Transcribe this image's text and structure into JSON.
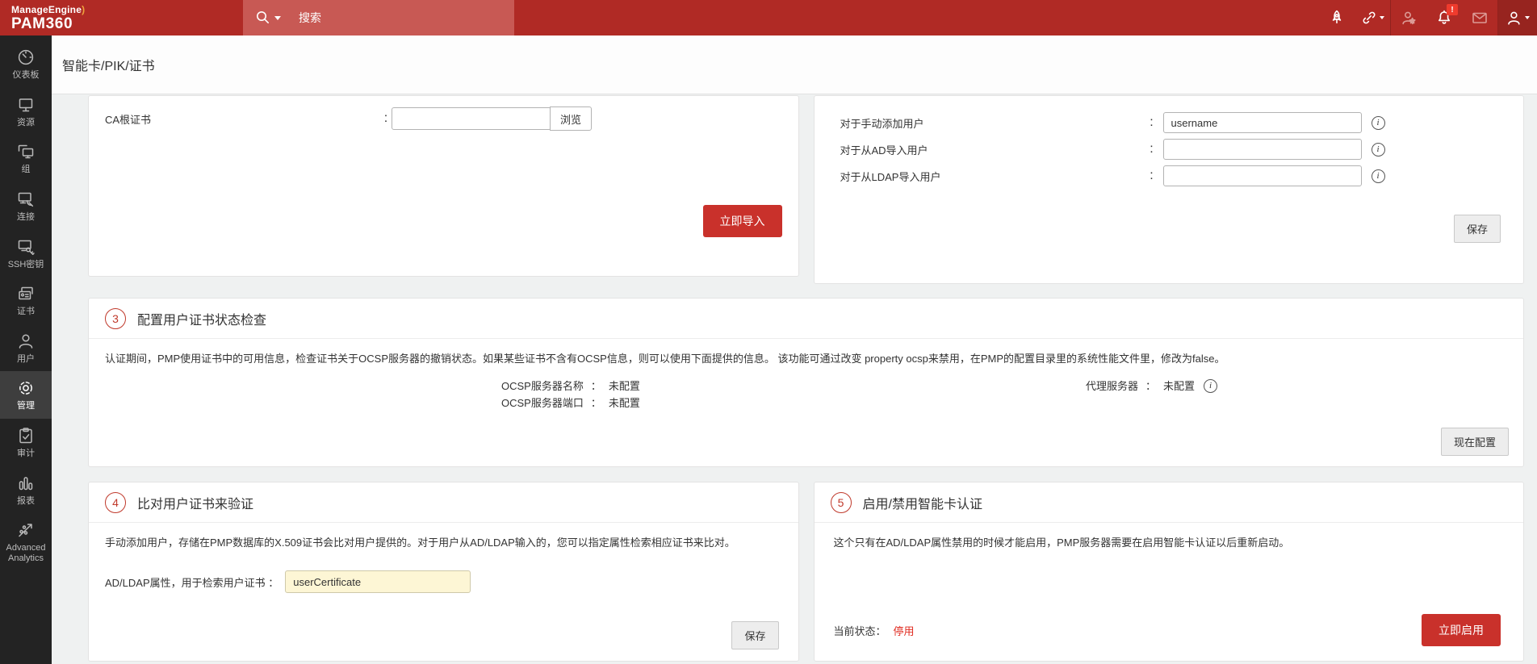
{
  "header": {
    "logo_line1": "ManageEngine",
    "logo_swoosh": ")",
    "logo_line2": "PAM360",
    "search_placeholder": "搜索",
    "icons": [
      "search-icon",
      "rocket-icon",
      "link-icon",
      "user-star-icon",
      "notification-bell-icon",
      "mail-icon",
      "account-icon"
    ],
    "bell_badge": "!"
  },
  "sidebar": {
    "items": [
      {
        "label": "仪表板",
        "icon": "dashboard-gauge-icon",
        "active": false
      },
      {
        "label": "资源",
        "icon": "resources-monitor-icon",
        "active": false
      },
      {
        "label": "组",
        "icon": "groups-monitors-icon",
        "active": false
      },
      {
        "label": "连接",
        "icon": "connections-monitor-dish-icon",
        "active": false
      },
      {
        "label": "SSH密钥",
        "icon": "ssh-keys-monitor-key-icon",
        "active": false
      },
      {
        "label": "证书",
        "icon": "certificates-idcard-icon",
        "active": false
      },
      {
        "label": "用户",
        "icon": "users-person-icon",
        "active": false
      },
      {
        "label": "管理",
        "icon": "admin-gear-icon",
        "active": true
      },
      {
        "label": "审计",
        "icon": "audit-clipboard-icon",
        "active": false
      },
      {
        "label": "报表",
        "icon": "reports-barchart-icon",
        "active": false
      },
      {
        "label": "Advanced Analytics",
        "icon": "advanced-analytics-scatter-icon",
        "active": false
      }
    ]
  },
  "page": {
    "title": "智能卡/PIK/证书"
  },
  "shared": {
    "colon_half": ":",
    "colon_full": "："
  },
  "panels": {
    "import_ca": {
      "label": "CA根证书",
      "browse_label": "浏览",
      "import_button": "立即导入"
    },
    "user_mapping": {
      "rows": [
        {
          "label": "对于手动添加用户",
          "value": "username"
        },
        {
          "label": "对于从AD导入用户",
          "value": ""
        },
        {
          "label": "对于从LDAP导入用户",
          "value": ""
        }
      ],
      "save_label": "保存"
    },
    "ocsp": {
      "number": "3",
      "title": "配置用户证书状态检查",
      "description": "认证期间，PMP使用证书中的可用信息，检查证书关于OCSP服务器的撤销状态。如果某些证书不含有OCSP信息，则可以使用下面提供的信息。 该功能可通过改变 property ocsp来禁用，在PMP的配置目录里的系统性能文件里，修改为false。",
      "fields": [
        {
          "label": "OCSP服务器名称",
          "value": "未配置"
        },
        {
          "label": "OCSP服务器端口",
          "value": "未配置"
        }
      ],
      "proxy_label": "代理服务器",
      "proxy_value": "未配置",
      "configure_button": "现在配置"
    },
    "compare": {
      "number": "4",
      "title": "比对用户证书来验证",
      "description": "手动添加用户，存储在PMP数据库的X.509证书会比对用户提供的。对于用户从AD/LDAP输入的，您可以指定属性检索相应证书来比对。",
      "attr_label": "AD/LDAP属性，用于检索用户证书 ：",
      "attr_value": "userCertificate",
      "save_label": "保存"
    },
    "enable": {
      "number": "5",
      "title": "启用/禁用智能卡认证",
      "description": "这个只有在AD/LDAP属性禁用的时候才能启用，PMP服务器需要在启用智能卡认证以后重新启动。",
      "status_label": "当前状态：",
      "status_value": "停用",
      "enable_button": "立即启用"
    }
  },
  "colors": {
    "header_red": "#b02a25",
    "search_red": "#c85954",
    "accent_red": "#c9312b",
    "status_disabled_red": "#e02b20",
    "sidebar_bg": "#232323",
    "sidebar_active_bg": "#3e3e3e",
    "content_bg": "#eff1f1",
    "yellow_input_bg": "#fdf6d5",
    "section_circle_red": "#c0392b"
  }
}
